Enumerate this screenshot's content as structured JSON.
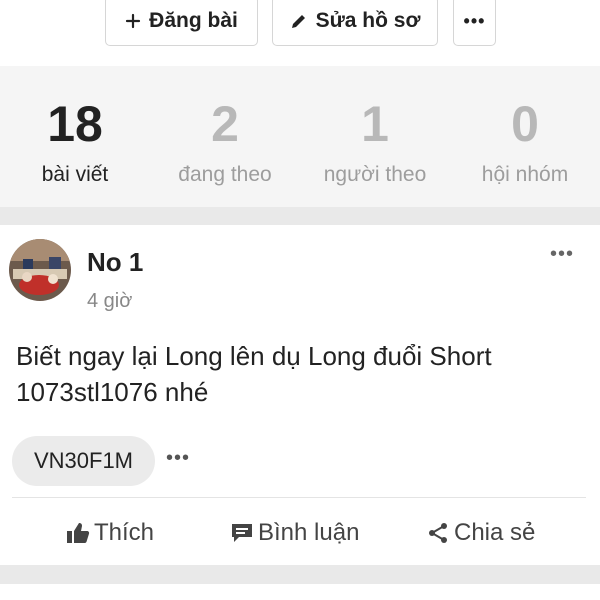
{
  "toolbar": {
    "post_label": "Đăng bài",
    "edit_label": "Sửa hồ sơ",
    "more_label": "•••"
  },
  "stats": [
    {
      "value": "18",
      "label": "bài viết"
    },
    {
      "value": "2",
      "label": "đang theo"
    },
    {
      "value": "1",
      "label": "người theo"
    },
    {
      "value": "0",
      "label": "hội nhóm"
    }
  ],
  "post": {
    "author": "No 1",
    "time": "4 giờ",
    "content_line1": "Biết ngay lại Long lên dụ Long đuổi Short",
    "content_line2": "1073stl1076 nhé",
    "tag": "VN30F1M",
    "tag_more": "•••",
    "menu": "•••",
    "actions": {
      "like": "Thích",
      "comment": "Bình luận",
      "share": "Chia sẻ"
    }
  }
}
